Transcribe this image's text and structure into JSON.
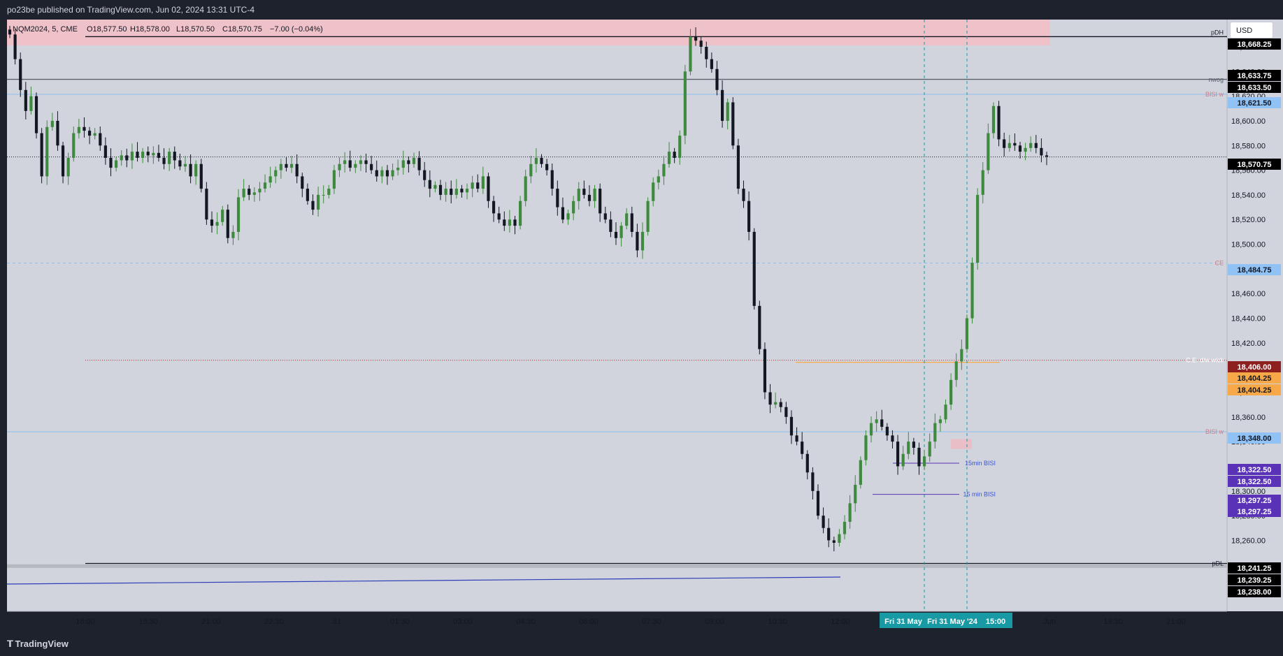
{
  "header": {
    "published_line": "po23be published on TradingView.com, Jun 02, 2024 13:31 UTC-4"
  },
  "footer": {
    "brand": "TradingView",
    "brand_icon": "tradingview-logo-icon"
  },
  "currency_button": "USD",
  "legend": {
    "symbol": "NQM2024, 5, CME",
    "open": "O18,577.50",
    "high": "H18,578.00",
    "low": "L18,570.50",
    "close": "C18,570.75",
    "change": "−7.00 (−0.04%)"
  },
  "colors": {
    "chart_bg": "#d1d4dc",
    "bull": "#3e8a3e",
    "bear": "#131722",
    "premium_zone": "#efc1c8",
    "bisi_line": "#8fc0f0",
    "ce_label": "#90c2f5",
    "orange_line": "#f7a94a",
    "dark_red_label": "#8e1f1f",
    "purple_label": "#5a32b8",
    "navy_line": "#2b3db8",
    "time_highlight": "#179aa3"
  },
  "chart_data": {
    "type": "candlestick",
    "symbol": "NQM2024",
    "timeframe": "5",
    "ylim": [
      18215,
      18690
    ],
    "y_ticks": [
      "18,660.00",
      "18,640.00",
      "18,620.00",
      "18,600.00",
      "18,580.00",
      "18,560.00",
      "18,540.00",
      "18,520.00",
      "18,500.00",
      "18,480.00",
      "18,460.00",
      "18,440.00",
      "18,420.00",
      "18,400.00",
      "18,380.00",
      "18,360.00",
      "18,340.00",
      "18,320.00",
      "18,300.00",
      "18,280.00",
      "18,260.00",
      "18,240.00"
    ],
    "x_ticks": [
      "18:00",
      "19:30",
      "21:00",
      "22:30",
      "31",
      "01:30",
      "03:00",
      "04:30",
      "06:00",
      "07:30",
      "09:00",
      "10:30",
      "12:00",
      "Jun",
      "19:30",
      "21:00"
    ],
    "time_highlight": [
      "Fri 31 May",
      "Fri 31 May '24",
      "15:00"
    ],
    "levels": [
      {
        "name": "pDH",
        "price": 18668.25,
        "label": "pDH",
        "tag": "18,668.25"
      },
      {
        "name": "nwog-top",
        "price": 18633.75,
        "label": "",
        "tag": "18,633.75"
      },
      {
        "name": "nwog",
        "price": 18633.5,
        "label": "nwog",
        "tag": "18,633.50"
      },
      {
        "name": "bisi-w-upper",
        "price": 18621.5,
        "label": "BISI w",
        "tag": "18,621.50"
      },
      {
        "name": "last-price",
        "price": 18570.75,
        "label": "",
        "tag": "18,570.75"
      },
      {
        "name": "ce",
        "price": 18484.75,
        "label": "CE",
        "tag": "18,484.75"
      },
      {
        "name": "ce-dw-wick",
        "price": 18406.0,
        "label": "C.E. d/w wick",
        "tag": "18,406.00"
      },
      {
        "name": "orange-1",
        "price": 18404.25,
        "label": "",
        "tag": "18,404.25"
      },
      {
        "name": "orange-2",
        "price": 18404.25,
        "label": "",
        "tag": "18,404.25"
      },
      {
        "name": "bisi-w-lower",
        "price": 18348.0,
        "label": "BISI w",
        "tag": "18,348.00"
      },
      {
        "name": "bisi-15min-a",
        "price": 18322.5,
        "label": "15min BISI",
        "tag": "18,322.50"
      },
      {
        "name": "bisi-15min-b",
        "price": 18322.5,
        "label": "",
        "tag": "18,322.50"
      },
      {
        "name": "bisi-15-min-a",
        "price": 18297.25,
        "label": "15 min BISI",
        "tag": "18,297.25"
      },
      {
        "name": "bisi-15-min-b",
        "price": 18297.25,
        "label": "",
        "tag": "18,297.25"
      },
      {
        "name": "pDL",
        "price": 18241.25,
        "label": "pDL",
        "tag": "18,241.25"
      },
      {
        "name": "low-2",
        "price": 18239.25,
        "label": "",
        "tag": "18,239.25"
      },
      {
        "name": "low-3",
        "price": 18238.0,
        "label": "",
        "tag": "18,238.00"
      }
    ],
    "closes": [
      18670,
      18650,
      18625,
      18608,
      18620,
      18590,
      18555,
      18595,
      18600,
      18580,
      18555,
      18570,
      18590,
      18595,
      18592,
      18588,
      18590,
      18580,
      18570,
      18562,
      18568,
      18572,
      18568,
      18575,
      18570,
      18575,
      18572,
      18574,
      18570,
      18565,
      18575,
      18568,
      18563,
      18565,
      18555,
      18565,
      18545,
      18520,
      18515,
      18518,
      18528,
      18505,
      18510,
      18538,
      18545,
      18540,
      18542,
      18545,
      18550,
      18555,
      18560,
      18565,
      18562,
      18565,
      18555,
      18545,
      18535,
      18528,
      18540,
      18540,
      18545,
      18560,
      18565,
      18568,
      18562,
      18565,
      18568,
      18565,
      18560,
      18555,
      18560,
      18555,
      18560,
      18562,
      18568,
      18565,
      18570,
      18560,
      18552,
      18545,
      18548,
      18540,
      18545,
      18540,
      18545,
      18542,
      18545,
      18550,
      18545,
      18555,
      18535,
      18525,
      18520,
      18515,
      18520,
      18515,
      18535,
      18555,
      18565,
      18570,
      18565,
      18560,
      18545,
      18530,
      18520,
      18525,
      18535,
      18545,
      18540,
      18535,
      18545,
      18525,
      18520,
      18510,
      18505,
      18515,
      18525,
      18510,
      18495,
      18510,
      18535,
      18550,
      18555,
      18565,
      18575,
      18570,
      18588,
      18640,
      18668,
      18665,
      18660,
      18650,
      18642,
      18625,
      18600,
      18615,
      18580,
      18545,
      18535,
      18510,
      18450,
      18415,
      18380,
      18370,
      18372,
      18368,
      18360,
      18345,
      18340,
      18330,
      18315,
      18300,
      18280,
      18270,
      18260,
      18258,
      18265,
      18275,
      18290,
      18305,
      18325,
      18345,
      18355,
      18358,
      18352,
      18345,
      18340,
      18320,
      18330,
      18340,
      18335,
      18320,
      18328,
      18340,
      18355,
      18358,
      18370,
      18390,
      18405,
      18415,
      18440,
      18485,
      18540,
      18560,
      18590,
      18612,
      18585,
      18578,
      18582,
      18580,
      18575,
      18578,
      18582,
      18578,
      18572,
      18571
    ]
  }
}
